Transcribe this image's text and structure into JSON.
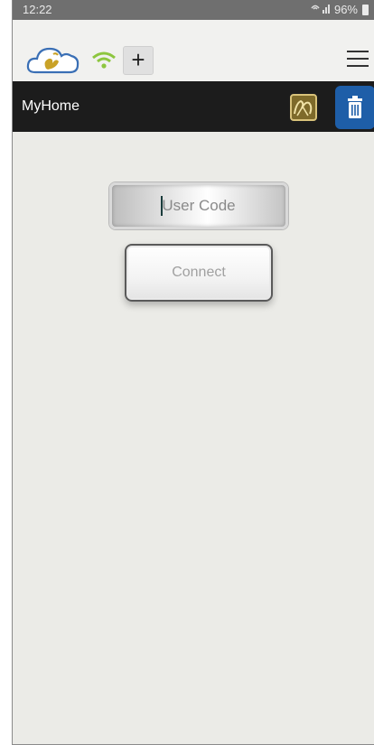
{
  "status_bar": {
    "time": "12:22",
    "battery_text": "96%"
  },
  "toolbar": {
    "add_label": "+"
  },
  "header": {
    "title": "MyHome"
  },
  "login": {
    "user_code_placeholder": "User Code",
    "connect_label": "Connect"
  },
  "colors": {
    "header_bg": "#1c1c1c",
    "delete_button": "#1e5ea8",
    "wifi_green": "#8dc63f",
    "logo_gold": "#c9a227"
  },
  "icons": {
    "logo": "cloud-swan-logo",
    "wifi": "wifi-icon",
    "add": "plus-icon",
    "menu": "hamburger-menu-icon",
    "swap": "swan-pattern-icon",
    "delete": "trash-icon"
  }
}
